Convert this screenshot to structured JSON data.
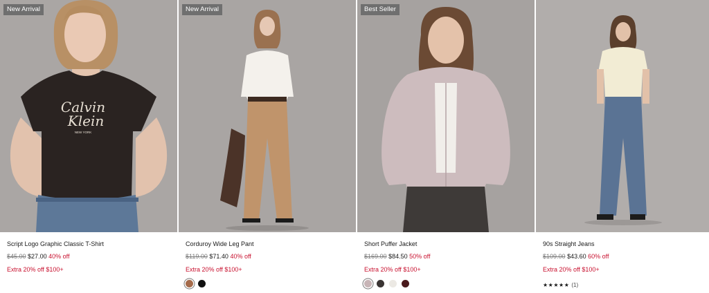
{
  "products": [
    {
      "badge": "New Arrival",
      "name": "Script Logo Graphic Classic T-Shirt",
      "original_price": "$45.00",
      "sale_price": "$27.00",
      "discount": "40% off",
      "promo": "Extra 20% off $100+",
      "shirt_text_1": "Calvin",
      "shirt_text_2": "Klein",
      "shirt_text_3": "NEW YORK",
      "bg_color": "#aaa6a4"
    },
    {
      "badge": "New Arrival",
      "name": "Corduroy Wide Leg Pant",
      "original_price": "$119.00",
      "sale_price": "$71.40",
      "discount": "40% off",
      "promo": "Extra 20% off $100+",
      "swatches": [
        "#a56b4b",
        "#111111"
      ],
      "bg_color": "#a9a5a3"
    },
    {
      "badge": "Best Seller",
      "name": "Short Puffer Jacket",
      "original_price": "$169.00",
      "sale_price": "$84.50",
      "discount": "50% off",
      "promo": "Extra 20% off $100+",
      "swatches": [
        "#c7b4b6",
        "#3a3433",
        "#ece9e4",
        "#4a1a1c"
      ],
      "bg_color": "#a6a2a0"
    },
    {
      "name": "90s Straight Jeans",
      "original_price": "$109.00",
      "sale_price": "$43.60",
      "discount": "60% off",
      "promo": "Extra 20% off $100+",
      "stars": "★★★★★",
      "review_count": "(1)",
      "bg_color": "#b1adab"
    }
  ],
  "accent_color": "#c8102e"
}
